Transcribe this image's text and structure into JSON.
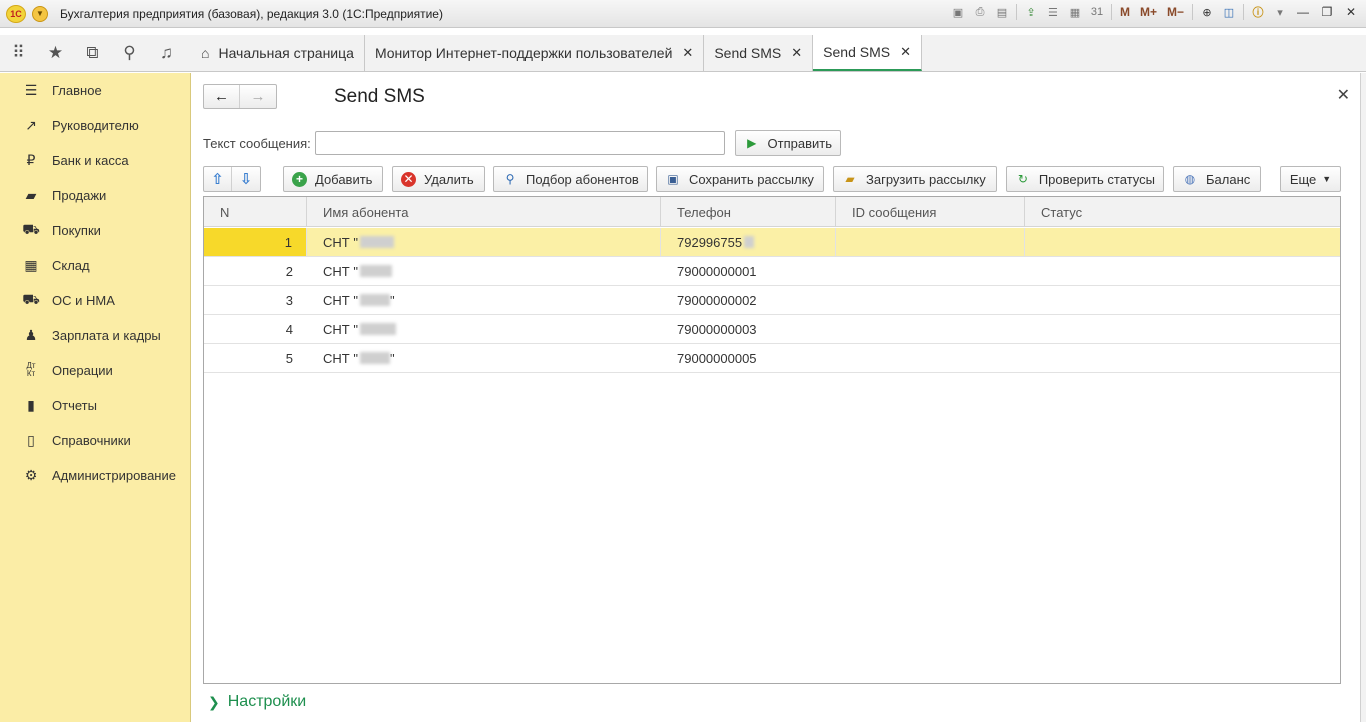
{
  "window": {
    "title": "Бухгалтерия предприятия (базовая), редакция 3.0  (1С:Предприятие)",
    "logo_text": "1С",
    "toolbar_m": [
      "M",
      "M+",
      "M−"
    ]
  },
  "tabs": [
    {
      "label": "Начальная страница",
      "active": false,
      "closable": false
    },
    {
      "label": "Монитор Интернет-поддержки пользователей",
      "active": false,
      "closable": true
    },
    {
      "label": "Send SMS",
      "active": false,
      "closable": true
    },
    {
      "label": "Send SMS",
      "active": true,
      "closable": true
    }
  ],
  "sidebar": {
    "items": [
      {
        "label": "Главное",
        "icon": "menu-lines-icon"
      },
      {
        "label": "Руководителю",
        "icon": "trend-icon"
      },
      {
        "label": "Банк и касса",
        "icon": "ruble-icon"
      },
      {
        "label": "Продажи",
        "icon": "bag-icon"
      },
      {
        "label": "Покупки",
        "icon": "cart-icon"
      },
      {
        "label": "Склад",
        "icon": "warehouse-icon"
      },
      {
        "label": "ОС и НМА",
        "icon": "truck-icon"
      },
      {
        "label": "Зарплата и кадры",
        "icon": "person-icon"
      },
      {
        "label": "Операции",
        "icon": "dt-kt-icon"
      },
      {
        "label": "Отчеты",
        "icon": "bar-chart-icon"
      },
      {
        "label": "Справочники",
        "icon": "book-icon"
      },
      {
        "label": "Администрирование",
        "icon": "gear-icon"
      }
    ]
  },
  "form": {
    "title": "Send SMS",
    "message_label": "Текст сообщения:",
    "message_value": "",
    "send_button": "Отправить",
    "toolbar": {
      "add": "Добавить",
      "delete": "Удалить",
      "pick": "Подбор абонентов",
      "save": "Сохранить рассылку",
      "load": "Загрузить рассылку",
      "check": "Проверить статусы",
      "balance": "Баланс",
      "more": "Еще"
    },
    "table": {
      "columns": [
        "N",
        "Имя абонента",
        "Телефон",
        "ID сообщения",
        "Статус"
      ],
      "rows": [
        {
          "n": "1",
          "name": "СНТ \"",
          "phone": "792996755",
          "id": "",
          "status": "",
          "selected": true
        },
        {
          "n": "2",
          "name": "СНТ \"",
          "phone": "79000000001",
          "id": "",
          "status": "",
          "selected": false
        },
        {
          "n": "3",
          "name": "СНТ \"",
          "phone": "79000000002",
          "id": "",
          "status": "",
          "selected": false
        },
        {
          "n": "4",
          "name": "СНТ \"",
          "phone": "79000000003",
          "id": "",
          "status": "",
          "selected": false
        },
        {
          "n": "5",
          "name": "СНТ \"",
          "phone": "79000000005",
          "id": "",
          "status": "",
          "selected": false
        }
      ]
    },
    "settings_label": "Настройки"
  }
}
